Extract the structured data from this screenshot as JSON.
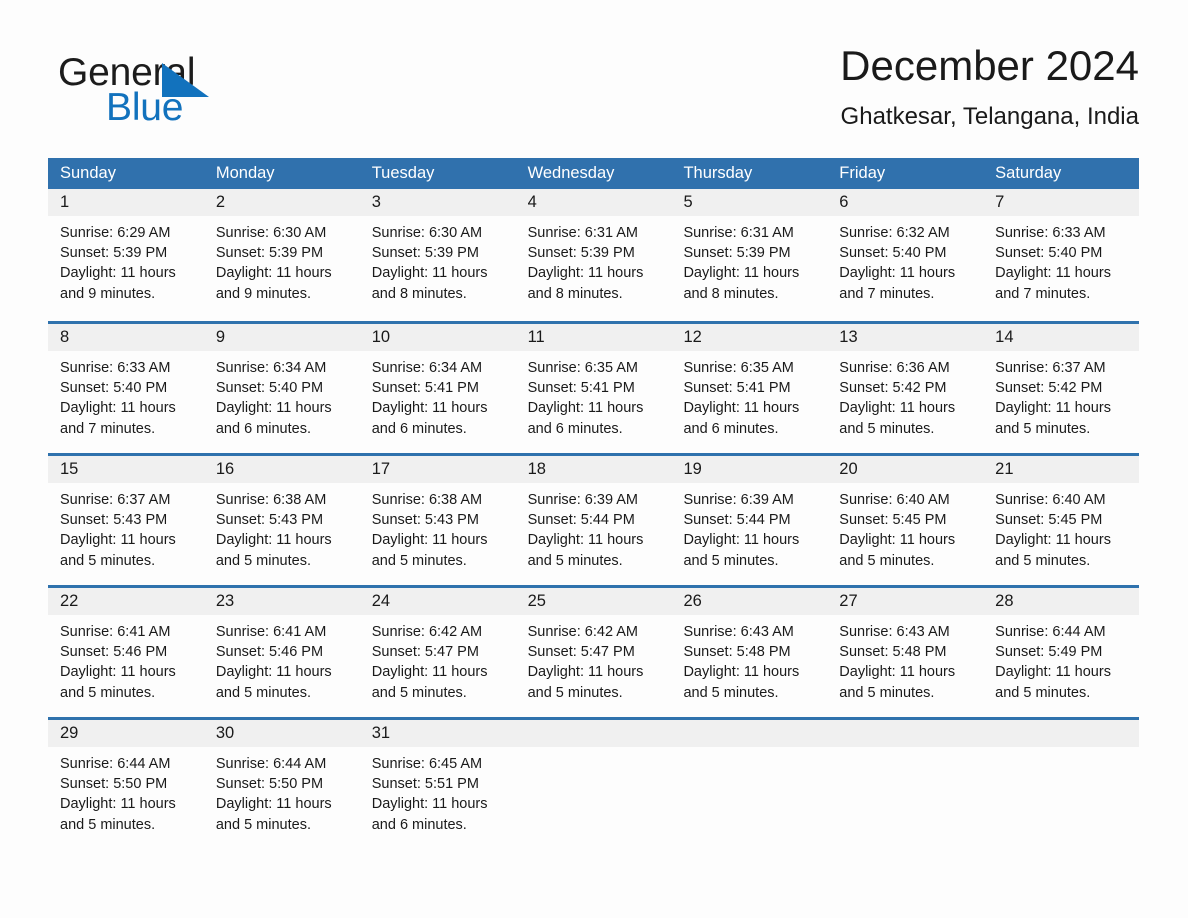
{
  "brand": {
    "name_line1": "General",
    "name_line2": "Blue",
    "logo_icon": "triangle-logo-icon",
    "accent_color": "#1272bd"
  },
  "header": {
    "title": "December 2024",
    "location": "Ghatkesar, Telangana, India"
  },
  "calendar": {
    "header_bg": "#3071ad",
    "row_border_color": "#2f72ad",
    "day_band_bg": "#f0f0f0",
    "weekdays": [
      "Sunday",
      "Monday",
      "Tuesday",
      "Wednesday",
      "Thursday",
      "Friday",
      "Saturday"
    ],
    "weeks": [
      [
        {
          "day": "1",
          "sunrise": "Sunrise: 6:29 AM",
          "sunset": "Sunset: 5:39 PM",
          "daylight": "Daylight: 11 hours and 9 minutes."
        },
        {
          "day": "2",
          "sunrise": "Sunrise: 6:30 AM",
          "sunset": "Sunset: 5:39 PM",
          "daylight": "Daylight: 11 hours and 9 minutes."
        },
        {
          "day": "3",
          "sunrise": "Sunrise: 6:30 AM",
          "sunset": "Sunset: 5:39 PM",
          "daylight": "Daylight: 11 hours and 8 minutes."
        },
        {
          "day": "4",
          "sunrise": "Sunrise: 6:31 AM",
          "sunset": "Sunset: 5:39 PM",
          "daylight": "Daylight: 11 hours and 8 minutes."
        },
        {
          "day": "5",
          "sunrise": "Sunrise: 6:31 AM",
          "sunset": "Sunset: 5:39 PM",
          "daylight": "Daylight: 11 hours and 8 minutes."
        },
        {
          "day": "6",
          "sunrise": "Sunrise: 6:32 AM",
          "sunset": "Sunset: 5:40 PM",
          "daylight": "Daylight: 11 hours and 7 minutes."
        },
        {
          "day": "7",
          "sunrise": "Sunrise: 6:33 AM",
          "sunset": "Sunset: 5:40 PM",
          "daylight": "Daylight: 11 hours and 7 minutes."
        }
      ],
      [
        {
          "day": "8",
          "sunrise": "Sunrise: 6:33 AM",
          "sunset": "Sunset: 5:40 PM",
          "daylight": "Daylight: 11 hours and 7 minutes."
        },
        {
          "day": "9",
          "sunrise": "Sunrise: 6:34 AM",
          "sunset": "Sunset: 5:40 PM",
          "daylight": "Daylight: 11 hours and 6 minutes."
        },
        {
          "day": "10",
          "sunrise": "Sunrise: 6:34 AM",
          "sunset": "Sunset: 5:41 PM",
          "daylight": "Daylight: 11 hours and 6 minutes."
        },
        {
          "day": "11",
          "sunrise": "Sunrise: 6:35 AM",
          "sunset": "Sunset: 5:41 PM",
          "daylight": "Daylight: 11 hours and 6 minutes."
        },
        {
          "day": "12",
          "sunrise": "Sunrise: 6:35 AM",
          "sunset": "Sunset: 5:41 PM",
          "daylight": "Daylight: 11 hours and 6 minutes."
        },
        {
          "day": "13",
          "sunrise": "Sunrise: 6:36 AM",
          "sunset": "Sunset: 5:42 PM",
          "daylight": "Daylight: 11 hours and 5 minutes."
        },
        {
          "day": "14",
          "sunrise": "Sunrise: 6:37 AM",
          "sunset": "Sunset: 5:42 PM",
          "daylight": "Daylight: 11 hours and 5 minutes."
        }
      ],
      [
        {
          "day": "15",
          "sunrise": "Sunrise: 6:37 AM",
          "sunset": "Sunset: 5:43 PM",
          "daylight": "Daylight: 11 hours and 5 minutes."
        },
        {
          "day": "16",
          "sunrise": "Sunrise: 6:38 AM",
          "sunset": "Sunset: 5:43 PM",
          "daylight": "Daylight: 11 hours and 5 minutes."
        },
        {
          "day": "17",
          "sunrise": "Sunrise: 6:38 AM",
          "sunset": "Sunset: 5:43 PM",
          "daylight": "Daylight: 11 hours and 5 minutes."
        },
        {
          "day": "18",
          "sunrise": "Sunrise: 6:39 AM",
          "sunset": "Sunset: 5:44 PM",
          "daylight": "Daylight: 11 hours and 5 minutes."
        },
        {
          "day": "19",
          "sunrise": "Sunrise: 6:39 AM",
          "sunset": "Sunset: 5:44 PM",
          "daylight": "Daylight: 11 hours and 5 minutes."
        },
        {
          "day": "20",
          "sunrise": "Sunrise: 6:40 AM",
          "sunset": "Sunset: 5:45 PM",
          "daylight": "Daylight: 11 hours and 5 minutes."
        },
        {
          "day": "21",
          "sunrise": "Sunrise: 6:40 AM",
          "sunset": "Sunset: 5:45 PM",
          "daylight": "Daylight: 11 hours and 5 minutes."
        }
      ],
      [
        {
          "day": "22",
          "sunrise": "Sunrise: 6:41 AM",
          "sunset": "Sunset: 5:46 PM",
          "daylight": "Daylight: 11 hours and 5 minutes."
        },
        {
          "day": "23",
          "sunrise": "Sunrise: 6:41 AM",
          "sunset": "Sunset: 5:46 PM",
          "daylight": "Daylight: 11 hours and 5 minutes."
        },
        {
          "day": "24",
          "sunrise": "Sunrise: 6:42 AM",
          "sunset": "Sunset: 5:47 PM",
          "daylight": "Daylight: 11 hours and 5 minutes."
        },
        {
          "day": "25",
          "sunrise": "Sunrise: 6:42 AM",
          "sunset": "Sunset: 5:47 PM",
          "daylight": "Daylight: 11 hours and 5 minutes."
        },
        {
          "day": "26",
          "sunrise": "Sunrise: 6:43 AM",
          "sunset": "Sunset: 5:48 PM",
          "daylight": "Daylight: 11 hours and 5 minutes."
        },
        {
          "day": "27",
          "sunrise": "Sunrise: 6:43 AM",
          "sunset": "Sunset: 5:48 PM",
          "daylight": "Daylight: 11 hours and 5 minutes."
        },
        {
          "day": "28",
          "sunrise": "Sunrise: 6:44 AM",
          "sunset": "Sunset: 5:49 PM",
          "daylight": "Daylight: 11 hours and 5 minutes."
        }
      ],
      [
        {
          "day": "29",
          "sunrise": "Sunrise: 6:44 AM",
          "sunset": "Sunset: 5:50 PM",
          "daylight": "Daylight: 11 hours and 5 minutes."
        },
        {
          "day": "30",
          "sunrise": "Sunrise: 6:44 AM",
          "sunset": "Sunset: 5:50 PM",
          "daylight": "Daylight: 11 hours and 5 minutes."
        },
        {
          "day": "31",
          "sunrise": "Sunrise: 6:45 AM",
          "sunset": "Sunset: 5:51 PM",
          "daylight": "Daylight: 11 hours and 6 minutes."
        },
        {
          "day": "",
          "sunrise": "",
          "sunset": "",
          "daylight": ""
        },
        {
          "day": "",
          "sunrise": "",
          "sunset": "",
          "daylight": ""
        },
        {
          "day": "",
          "sunrise": "",
          "sunset": "",
          "daylight": ""
        },
        {
          "day": "",
          "sunrise": "",
          "sunset": "",
          "daylight": ""
        }
      ]
    ]
  }
}
